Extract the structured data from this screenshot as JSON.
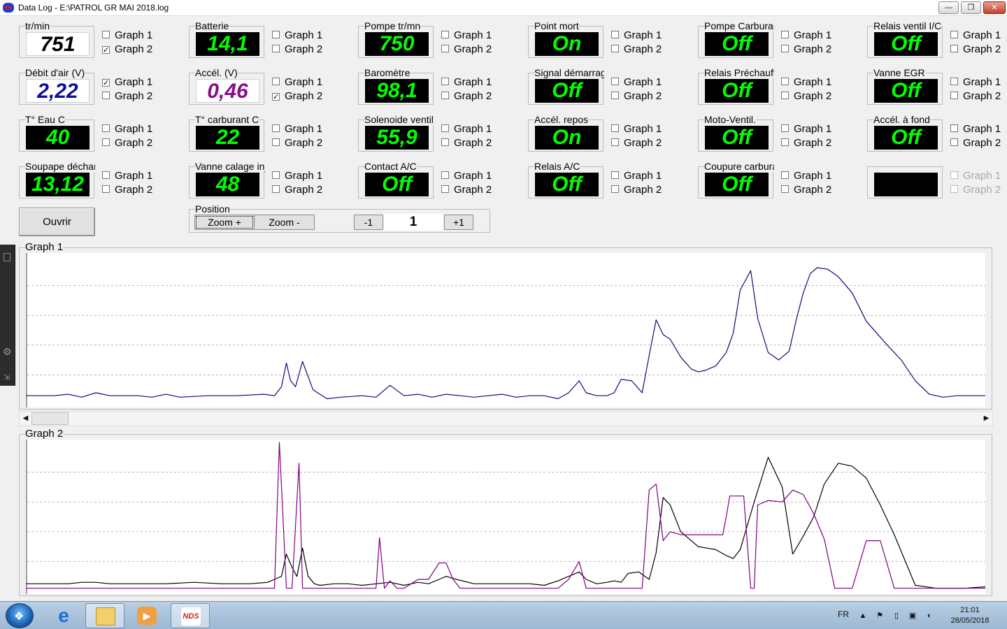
{
  "window": {
    "title": "Data Log - E:\\PATROL GR MAI 2018.log",
    "minimize_glyph": "—",
    "maximize_glyph": "❐",
    "close_glyph": "✕"
  },
  "checkbox_labels": {
    "g1": "Graph 1",
    "g2": "Graph 2"
  },
  "tiles": [
    {
      "id": "rpm",
      "label": "tr/min",
      "value": "751",
      "style": "white",
      "g1": false,
      "g2": true
    },
    {
      "id": "debit-air",
      "label": "Débit d'air (V)",
      "value": "2,22",
      "style": "blue",
      "g1": true,
      "g2": false
    },
    {
      "id": "eau",
      "label": "T° Eau C",
      "value": "40",
      "style": "black",
      "g1": false,
      "g2": false
    },
    {
      "id": "soupape",
      "label": "Soupape décharge",
      "value": "13,12",
      "style": "black",
      "g1": false,
      "g2": false
    },
    {
      "id": "batterie",
      "label": "Batterie",
      "value": "14,1",
      "style": "black",
      "g1": false,
      "g2": false
    },
    {
      "id": "accel",
      "label": "Accél. (V)",
      "value": "0,46",
      "style": "purple",
      "g1": false,
      "g2": true
    },
    {
      "id": "carburant",
      "label": "T° carburant C",
      "value": "22",
      "style": "black",
      "g1": false,
      "g2": false
    },
    {
      "id": "vanne-calage",
      "label": "Vanne calage injection",
      "value": "48",
      "style": "black",
      "g1": false,
      "g2": false
    },
    {
      "id": "pompe-rpm",
      "label": "Pompe tr/mn",
      "value": "750",
      "style": "black",
      "g1": false,
      "g2": false
    },
    {
      "id": "barometre",
      "label": "Baromètre",
      "value": "98,1",
      "style": "black",
      "g1": false,
      "g2": false
    },
    {
      "id": "solenoide",
      "label": "Solenoide ventil",
      "value": "55,9",
      "style": "black",
      "g1": false,
      "g2": false
    },
    {
      "id": "contact-ac",
      "label": "Contact A/C",
      "value": "Off",
      "style": "black",
      "g1": false,
      "g2": false
    },
    {
      "id": "point-mort",
      "label": "Point mort",
      "value": "On",
      "style": "black",
      "g1": false,
      "g2": false
    },
    {
      "id": "signal-demarrage",
      "label": "Signal démarrage",
      "value": "Off",
      "style": "black",
      "g1": false,
      "g2": false
    },
    {
      "id": "accel-repos",
      "label": "Accél. repos",
      "value": "On",
      "style": "black",
      "g1": false,
      "g2": false
    },
    {
      "id": "relais-ac",
      "label": "Relais A/C",
      "value": "Off",
      "style": "black",
      "g1": false,
      "g2": false
    },
    {
      "id": "pompe-carburant",
      "label": "Pompe Carburant",
      "value": "Off",
      "style": "black",
      "g1": false,
      "g2": false
    },
    {
      "id": "relais-prechauffage",
      "label": "Relais Préchauffage",
      "value": "Off",
      "style": "black",
      "g1": false,
      "g2": false
    },
    {
      "id": "moto-ventil",
      "label": "Moto-Ventil.",
      "value": "Off",
      "style": "black",
      "g1": false,
      "g2": false
    },
    {
      "id": "coupure-carburant",
      "label": "Coupure carburant",
      "value": "Off",
      "style": "black",
      "g1": false,
      "g2": false
    },
    {
      "id": "relais-ventil-ic",
      "label": "Relais ventil I/C",
      "value": "Off",
      "style": "black",
      "g1": false,
      "g2": false
    },
    {
      "id": "vanne-egr",
      "label": "Vanne EGR",
      "value": "Off",
      "style": "black",
      "g1": false,
      "g2": false
    },
    {
      "id": "accel-fond",
      "label": "Accél. à fond",
      "value": "Off",
      "style": "black",
      "g1": false,
      "g2": false
    },
    {
      "id": "empty",
      "label": "",
      "value": "",
      "style": "empty",
      "g1": false,
      "g2": false,
      "disabled": true
    }
  ],
  "controls": {
    "open_label": "Ouvrir",
    "position_label": "Position",
    "zoom_in_label": "Zoom +",
    "zoom_out_label": "Zoom -",
    "step_minus_label": "-1",
    "step_plus_label": "+1",
    "position_value": "1"
  },
  "scrollbar": {
    "left_glyph": "◀",
    "right_glyph": "▶"
  },
  "colors": {
    "series_blue": "#0c0c7a",
    "series_purple": "#800080",
    "series_black": "#000000",
    "grid": "#b8b8b8"
  },
  "chart_data": [
    {
      "type": "line",
      "title": "Graph 1",
      "xlim": [
        0,
        1370
      ],
      "ylim": [
        0,
        100
      ],
      "grid": "horizontal dashed",
      "series": [
        {
          "color": "#0c0c7a",
          "x": [
            0,
            40,
            60,
            80,
            100,
            120,
            160,
            180,
            200,
            220,
            260,
            300,
            340,
            355,
            365,
            372,
            378,
            385,
            395,
            410,
            430,
            450,
            480,
            500,
            520,
            540,
            560,
            580,
            600,
            620,
            640,
            660,
            680,
            700,
            720,
            740,
            760,
            775,
            790,
            800,
            815,
            830,
            840,
            850,
            865,
            880,
            890,
            900,
            910,
            920,
            935,
            950,
            960,
            970,
            985,
            1000,
            1010,
            1020,
            1035,
            1045,
            1060,
            1075,
            1090,
            1100,
            1110,
            1120,
            1130,
            1145,
            1160,
            1180,
            1200,
            1215,
            1230,
            1250,
            1270,
            1290,
            1310,
            1330,
            1370
          ],
          "y": [
            6,
            6,
            7,
            5,
            8,
            6,
            6,
            5,
            7,
            5,
            6,
            6,
            7,
            6,
            12,
            28,
            16,
            12,
            29,
            10,
            4,
            5,
            6,
            5,
            13,
            6,
            7,
            5,
            7,
            6,
            5,
            6,
            7,
            5,
            6,
            6,
            4,
            8,
            16,
            8,
            6,
            6,
            8,
            17,
            16,
            8,
            33,
            57,
            47,
            44,
            32,
            24,
            22,
            23,
            26,
            35,
            48,
            77,
            90,
            58,
            35,
            30,
            36,
            57,
            75,
            88,
            92,
            91,
            86,
            75,
            56,
            48,
            40,
            30,
            16,
            7,
            5,
            6,
            6
          ]
        }
      ]
    },
    {
      "type": "line",
      "title": "Graph 2",
      "xlim": [
        0,
        1370
      ],
      "ylim": [
        0,
        100
      ],
      "grid": "horizontal dashed",
      "series": [
        {
          "color": "#000000",
          "x": [
            0,
            40,
            60,
            80,
            100,
            120,
            160,
            200,
            240,
            280,
            320,
            345,
            355,
            365,
            372,
            380,
            387,
            395,
            403,
            412,
            420,
            440,
            460,
            480,
            500,
            520,
            540,
            560,
            575,
            590,
            600,
            615,
            640,
            680,
            720,
            740,
            760,
            775,
            790,
            800,
            815,
            830,
            840,
            850,
            860,
            875,
            890,
            900,
            910,
            920,
            935,
            960,
            985,
            1000,
            1010,
            1020,
            1040,
            1060,
            1080,
            1095,
            1110,
            1125,
            1140,
            1160,
            1180,
            1200,
            1220,
            1240,
            1270,
            1300,
            1340,
            1370
          ],
          "y": [
            5,
            5,
            5,
            6,
            6,
            5,
            5,
            5,
            6,
            5,
            5,
            6,
            8,
            10,
            25,
            16,
            10,
            29,
            10,
            5,
            4,
            5,
            5,
            4,
            5,
            6,
            4,
            6,
            5,
            8,
            10,
            8,
            5,
            5,
            5,
            4,
            7,
            10,
            13,
            8,
            5,
            6,
            7,
            6,
            12,
            13,
            8,
            26,
            63,
            58,
            40,
            30,
            28,
            24,
            22,
            28,
            60,
            90,
            70,
            25,
            37,
            50,
            72,
            86,
            84,
            76,
            58,
            38,
            4,
            2,
            2,
            3
          ]
        },
        {
          "color": "#800080",
          "x": [
            0,
            40,
            60,
            80,
            100,
            120,
            160,
            200,
            240,
            280,
            320,
            345,
            350,
            355,
            362,
            372,
            380,
            390,
            395,
            405,
            412,
            420,
            440,
            460,
            470,
            480,
            490,
            500,
            505,
            512,
            520,
            530,
            540,
            560,
            575,
            590,
            600,
            610,
            620,
            640,
            680,
            720,
            740,
            760,
            775,
            790,
            800,
            815,
            830,
            840,
            850,
            860,
            875,
            880,
            890,
            900,
            910,
            920,
            935,
            950,
            965,
            975,
            985,
            995,
            1000,
            1005,
            1010,
            1025,
            1035,
            1040,
            1045,
            1060,
            1080,
            1095,
            1110,
            1125,
            1140,
            1155,
            1165,
            1170,
            1180,
            1200,
            1220,
            1240,
            1270,
            1300,
            1340,
            1370
          ],
          "y": [
            2,
            2,
            2,
            2,
            2,
            2,
            2,
            2,
            2,
            2,
            2,
            2,
            2,
            2,
            100,
            2,
            2,
            86,
            2,
            2,
            2,
            2,
            2,
            2,
            2,
            2,
            2,
            2,
            36,
            2,
            7,
            2,
            2,
            8,
            8,
            19,
            19,
            8,
            2,
            2,
            2,
            2,
            2,
            2,
            8,
            20,
            2,
            2,
            2,
            2,
            2,
            2,
            2,
            2,
            68,
            72,
            34,
            40,
            38,
            38,
            38,
            38,
            38,
            38,
            50,
            64,
            64,
            64,
            2,
            2,
            58,
            61,
            60,
            68,
            65,
            52,
            35,
            2,
            2,
            2,
            2,
            34,
            34,
            2,
            2,
            2,
            2,
            2
          ]
        }
      ]
    }
  ],
  "taskbar": {
    "start_glyph": "❖",
    "ie_glyph": "e",
    "media_glyph": "▶",
    "nds_glyph": "NDS",
    "language": "FR",
    "tray_up_glyph": "▲",
    "time": "21:01",
    "date": "28/05/2018"
  }
}
